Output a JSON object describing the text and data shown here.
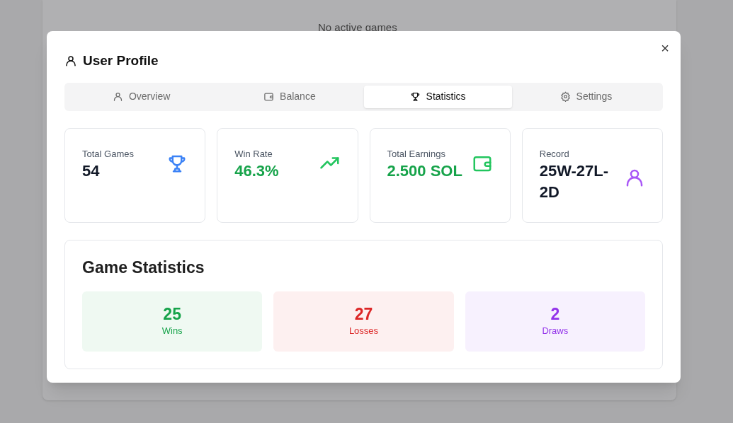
{
  "background_text": "No active games",
  "dialog": {
    "title": "User Profile",
    "close": "×"
  },
  "tabs": [
    {
      "label": "Overview",
      "kind": "user",
      "selected": false
    },
    {
      "label": "Balance",
      "kind": "wallet",
      "selected": false
    },
    {
      "label": "Statistics",
      "kind": "trophy",
      "selected": true
    },
    {
      "label": "Settings",
      "kind": "gear",
      "selected": false
    }
  ],
  "stat_cards": [
    {
      "label": "Total Games",
      "value": "54",
      "kind": "trophy",
      "color": "#3b82f6",
      "positive": false
    },
    {
      "label": "Win Rate",
      "value": "46.3%",
      "kind": "trend",
      "color": "#22c55e",
      "positive": true
    },
    {
      "label": "Total Earnings",
      "value": "2.500 SOL",
      "kind": "wallet",
      "color": "#22c55e",
      "positive": true
    },
    {
      "label": "Record",
      "value": "25W-27L-2D",
      "kind": "user",
      "color": "#a855f7",
      "positive": false
    }
  ],
  "game_statistics": {
    "title": "Game Statistics",
    "tallies": [
      {
        "value": "25",
        "label": "Wins",
        "color": "#16a34a"
      },
      {
        "value": "27",
        "label": "Losses",
        "color": "#dc2626"
      },
      {
        "value": "2",
        "label": "Draws",
        "color": "#9333ea"
      }
    ]
  }
}
